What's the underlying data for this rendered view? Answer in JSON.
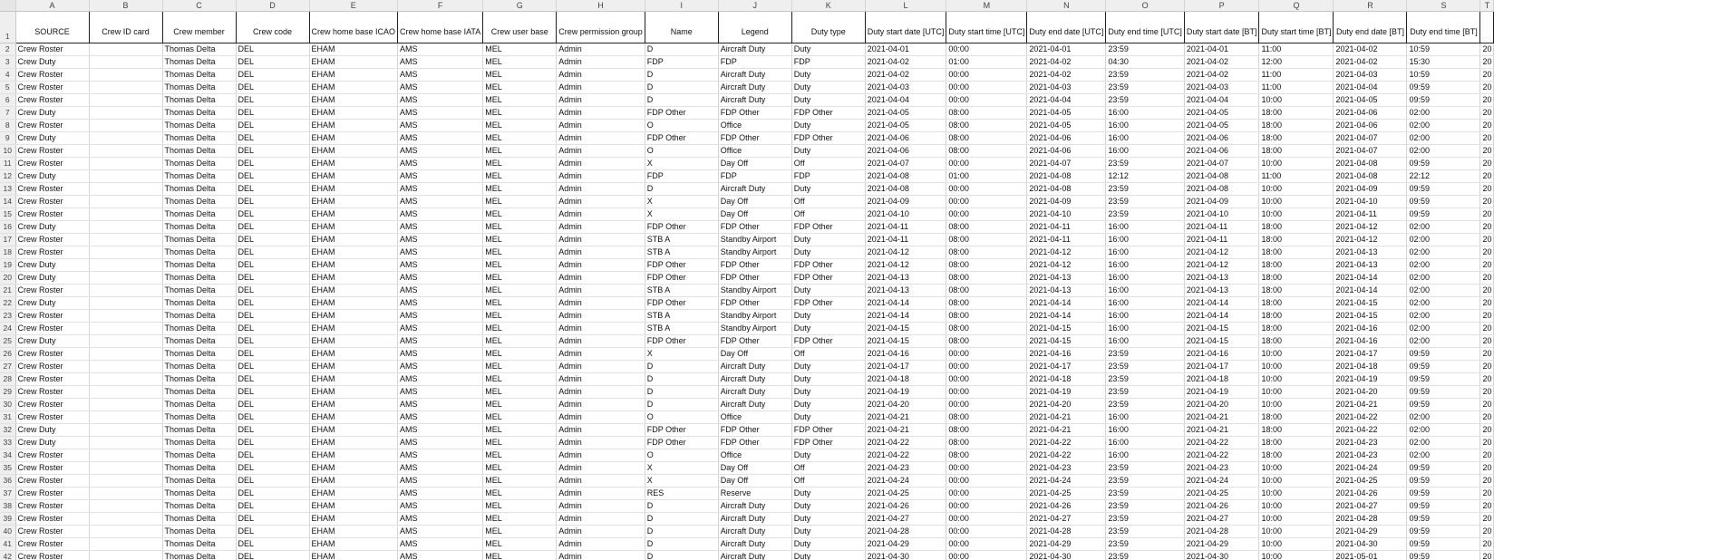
{
  "column_letters": [
    "A",
    "B",
    "C",
    "D",
    "E",
    "F",
    "G",
    "H",
    "I",
    "J",
    "K",
    "L",
    "M",
    "N",
    "O",
    "P",
    "Q",
    "R",
    "S",
    "T"
  ],
  "headers": [
    "SOURCE",
    "Crew ID card",
    "Crew member",
    "Crew code",
    "Crew home base ICAO",
    "Crew home base IATA",
    "Crew user base",
    "Crew permission group",
    "Name",
    "Legend",
    "Duty type",
    "Duty start date [UTC]",
    "Duty start time [UTC]",
    "Duty end date [UTC]",
    "Duty end time [UTC]",
    "Duty start date [BT]",
    "Duty start time [BT]",
    "Duty end date [BT]",
    "Duty end time [BT]",
    ""
  ],
  "row_numbers": [
    "1",
    "2",
    "3",
    "4",
    "5",
    "6",
    "7",
    "8",
    "9",
    "10",
    "11",
    "12",
    "13",
    "14",
    "15",
    "16",
    "17",
    "18",
    "19",
    "20",
    "21",
    "22",
    "23",
    "24",
    "25",
    "26",
    "27",
    "28",
    "29",
    "30",
    "31",
    "32",
    "33",
    "34",
    "35",
    "36",
    "37",
    "38",
    "39",
    "40",
    "41",
    "42"
  ],
  "rows": [
    [
      "Crew Roster",
      "",
      "Thomas Delta",
      "DEL",
      "EHAM",
      "AMS",
      "MEL",
      "Admin",
      "D",
      "Aircraft Duty",
      "Duty",
      "2021-04-01",
      "00:00",
      "2021-04-01",
      "23:59",
      "2021-04-01",
      "11:00",
      "2021-04-02",
      "10:59",
      "20"
    ],
    [
      "Crew Duty",
      "",
      "Thomas Delta",
      "DEL",
      "EHAM",
      "AMS",
      "MEL",
      "Admin",
      "FDP",
      "FDP",
      "FDP",
      "2021-04-02",
      "01:00",
      "2021-04-02",
      "04:30",
      "2021-04-02",
      "12:00",
      "2021-04-02",
      "15:30",
      "20"
    ],
    [
      "Crew Roster",
      "",
      "Thomas Delta",
      "DEL",
      "EHAM",
      "AMS",
      "MEL",
      "Admin",
      "D",
      "Aircraft Duty",
      "Duty",
      "2021-04-02",
      "00:00",
      "2021-04-02",
      "23:59",
      "2021-04-02",
      "11:00",
      "2021-04-03",
      "10:59",
      "20"
    ],
    [
      "Crew Roster",
      "",
      "Thomas Delta",
      "DEL",
      "EHAM",
      "AMS",
      "MEL",
      "Admin",
      "D",
      "Aircraft Duty",
      "Duty",
      "2021-04-03",
      "00:00",
      "2021-04-03",
      "23:59",
      "2021-04-03",
      "11:00",
      "2021-04-04",
      "09:59",
      "20"
    ],
    [
      "Crew Roster",
      "",
      "Thomas Delta",
      "DEL",
      "EHAM",
      "AMS",
      "MEL",
      "Admin",
      "D",
      "Aircraft Duty",
      "Duty",
      "2021-04-04",
      "00:00",
      "2021-04-04",
      "23:59",
      "2021-04-04",
      "10:00",
      "2021-04-05",
      "09:59",
      "20"
    ],
    [
      "Crew Duty",
      "",
      "Thomas Delta",
      "DEL",
      "EHAM",
      "AMS",
      "MEL",
      "Admin",
      "FDP Other",
      "FDP Other",
      "FDP Other",
      "2021-04-05",
      "08:00",
      "2021-04-05",
      "16:00",
      "2021-04-05",
      "18:00",
      "2021-04-06",
      "02:00",
      "20"
    ],
    [
      "Crew Roster",
      "",
      "Thomas Delta",
      "DEL",
      "EHAM",
      "AMS",
      "MEL",
      "Admin",
      "O",
      "Office",
      "Duty",
      "2021-04-05",
      "08:00",
      "2021-04-05",
      "16:00",
      "2021-04-05",
      "18:00",
      "2021-04-06",
      "02:00",
      "20"
    ],
    [
      "Crew Duty",
      "",
      "Thomas Delta",
      "DEL",
      "EHAM",
      "AMS",
      "MEL",
      "Admin",
      "FDP Other",
      "FDP Other",
      "FDP Other",
      "2021-04-06",
      "08:00",
      "2021-04-06",
      "16:00",
      "2021-04-06",
      "18:00",
      "2021-04-07",
      "02:00",
      "20"
    ],
    [
      "Crew Roster",
      "",
      "Thomas Delta",
      "DEL",
      "EHAM",
      "AMS",
      "MEL",
      "Admin",
      "O",
      "Office",
      "Duty",
      "2021-04-06",
      "08:00",
      "2021-04-06",
      "16:00",
      "2021-04-06",
      "18:00",
      "2021-04-07",
      "02:00",
      "20"
    ],
    [
      "Crew Roster",
      "",
      "Thomas Delta",
      "DEL",
      "EHAM",
      "AMS",
      "MEL",
      "Admin",
      "X",
      "Day Off",
      "Off",
      "2021-04-07",
      "00:00",
      "2021-04-07",
      "23:59",
      "2021-04-07",
      "10:00",
      "2021-04-08",
      "09:59",
      "20"
    ],
    [
      "Crew Duty",
      "",
      "Thomas Delta",
      "DEL",
      "EHAM",
      "AMS",
      "MEL",
      "Admin",
      "FDP",
      "FDP",
      "FDP",
      "2021-04-08",
      "01:00",
      "2021-04-08",
      "12:12",
      "2021-04-08",
      "11:00",
      "2021-04-08",
      "22:12",
      "20"
    ],
    [
      "Crew Roster",
      "",
      "Thomas Delta",
      "DEL",
      "EHAM",
      "AMS",
      "MEL",
      "Admin",
      "D",
      "Aircraft Duty",
      "Duty",
      "2021-04-08",
      "00:00",
      "2021-04-08",
      "23:59",
      "2021-04-08",
      "10:00",
      "2021-04-09",
      "09:59",
      "20"
    ],
    [
      "Crew Roster",
      "",
      "Thomas Delta",
      "DEL",
      "EHAM",
      "AMS",
      "MEL",
      "Admin",
      "X",
      "Day Off",
      "Off",
      "2021-04-09",
      "00:00",
      "2021-04-09",
      "23:59",
      "2021-04-09",
      "10:00",
      "2021-04-10",
      "09:59",
      "20"
    ],
    [
      "Crew Roster",
      "",
      "Thomas Delta",
      "DEL",
      "EHAM",
      "AMS",
      "MEL",
      "Admin",
      "X",
      "Day Off",
      "Off",
      "2021-04-10",
      "00:00",
      "2021-04-10",
      "23:59",
      "2021-04-10",
      "10:00",
      "2021-04-11",
      "09:59",
      "20"
    ],
    [
      "Crew Duty",
      "",
      "Thomas Delta",
      "DEL",
      "EHAM",
      "AMS",
      "MEL",
      "Admin",
      "FDP Other",
      "FDP Other",
      "FDP Other",
      "2021-04-11",
      "08:00",
      "2021-04-11",
      "16:00",
      "2021-04-11",
      "18:00",
      "2021-04-12",
      "02:00",
      "20"
    ],
    [
      "Crew Roster",
      "",
      "Thomas Delta",
      "DEL",
      "EHAM",
      "AMS",
      "MEL",
      "Admin",
      "STB A",
      "Standby Airport",
      "Duty",
      "2021-04-11",
      "08:00",
      "2021-04-11",
      "16:00",
      "2021-04-11",
      "18:00",
      "2021-04-12",
      "02:00",
      "20"
    ],
    [
      "Crew Roster",
      "",
      "Thomas Delta",
      "DEL",
      "EHAM",
      "AMS",
      "MEL",
      "Admin",
      "STB A",
      "Standby Airport",
      "Duty",
      "2021-04-12",
      "08:00",
      "2021-04-12",
      "16:00",
      "2021-04-12",
      "18:00",
      "2021-04-13",
      "02:00",
      "20"
    ],
    [
      "Crew Duty",
      "",
      "Thomas Delta",
      "DEL",
      "EHAM",
      "AMS",
      "MEL",
      "Admin",
      "FDP Other",
      "FDP Other",
      "FDP Other",
      "2021-04-12",
      "08:00",
      "2021-04-12",
      "16:00",
      "2021-04-12",
      "18:00",
      "2021-04-13",
      "02:00",
      "20"
    ],
    [
      "Crew Duty",
      "",
      "Thomas Delta",
      "DEL",
      "EHAM",
      "AMS",
      "MEL",
      "Admin",
      "FDP Other",
      "FDP Other",
      "FDP Other",
      "2021-04-13",
      "08:00",
      "2021-04-13",
      "16:00",
      "2021-04-13",
      "18:00",
      "2021-04-14",
      "02:00",
      "20"
    ],
    [
      "Crew Roster",
      "",
      "Thomas Delta",
      "DEL",
      "EHAM",
      "AMS",
      "MEL",
      "Admin",
      "STB A",
      "Standby Airport",
      "Duty",
      "2021-04-13",
      "08:00",
      "2021-04-13",
      "16:00",
      "2021-04-13",
      "18:00",
      "2021-04-14",
      "02:00",
      "20"
    ],
    [
      "Crew Duty",
      "",
      "Thomas Delta",
      "DEL",
      "EHAM",
      "AMS",
      "MEL",
      "Admin",
      "FDP Other",
      "FDP Other",
      "FDP Other",
      "2021-04-14",
      "08:00",
      "2021-04-14",
      "16:00",
      "2021-04-14",
      "18:00",
      "2021-04-15",
      "02:00",
      "20"
    ],
    [
      "Crew Roster",
      "",
      "Thomas Delta",
      "DEL",
      "EHAM",
      "AMS",
      "MEL",
      "Admin",
      "STB A",
      "Standby Airport",
      "Duty",
      "2021-04-14",
      "08:00",
      "2021-04-14",
      "16:00",
      "2021-04-14",
      "18:00",
      "2021-04-15",
      "02:00",
      "20"
    ],
    [
      "Crew Roster",
      "",
      "Thomas Delta",
      "DEL",
      "EHAM",
      "AMS",
      "MEL",
      "Admin",
      "STB A",
      "Standby Airport",
      "Duty",
      "2021-04-15",
      "08:00",
      "2021-04-15",
      "16:00",
      "2021-04-15",
      "18:00",
      "2021-04-16",
      "02:00",
      "20"
    ],
    [
      "Crew Duty",
      "",
      "Thomas Delta",
      "DEL",
      "EHAM",
      "AMS",
      "MEL",
      "Admin",
      "FDP Other",
      "FDP Other",
      "FDP Other",
      "2021-04-15",
      "08:00",
      "2021-04-15",
      "16:00",
      "2021-04-15",
      "18:00",
      "2021-04-16",
      "02:00",
      "20"
    ],
    [
      "Crew Roster",
      "",
      "Thomas Delta",
      "DEL",
      "EHAM",
      "AMS",
      "MEL",
      "Admin",
      "X",
      "Day Off",
      "Off",
      "2021-04-16",
      "00:00",
      "2021-04-16",
      "23:59",
      "2021-04-16",
      "10:00",
      "2021-04-17",
      "09:59",
      "20"
    ],
    [
      "Crew Roster",
      "",
      "Thomas Delta",
      "DEL",
      "EHAM",
      "AMS",
      "MEL",
      "Admin",
      "D",
      "Aircraft Duty",
      "Duty",
      "2021-04-17",
      "00:00",
      "2021-04-17",
      "23:59",
      "2021-04-17",
      "10:00",
      "2021-04-18",
      "09:59",
      "20"
    ],
    [
      "Crew Roster",
      "",
      "Thomas Delta",
      "DEL",
      "EHAM",
      "AMS",
      "MEL",
      "Admin",
      "D",
      "Aircraft Duty",
      "Duty",
      "2021-04-18",
      "00:00",
      "2021-04-18",
      "23:59",
      "2021-04-18",
      "10:00",
      "2021-04-19",
      "09:59",
      "20"
    ],
    [
      "Crew Roster",
      "",
      "Thomas Delta",
      "DEL",
      "EHAM",
      "AMS",
      "MEL",
      "Admin",
      "D",
      "Aircraft Duty",
      "Duty",
      "2021-04-19",
      "00:00",
      "2021-04-19",
      "23:59",
      "2021-04-19",
      "10:00",
      "2021-04-20",
      "09:59",
      "20"
    ],
    [
      "Crew Roster",
      "",
      "Thomas Delta",
      "DEL",
      "EHAM",
      "AMS",
      "MEL",
      "Admin",
      "D",
      "Aircraft Duty",
      "Duty",
      "2021-04-20",
      "00:00",
      "2021-04-20",
      "23:59",
      "2021-04-20",
      "10:00",
      "2021-04-21",
      "09:59",
      "20"
    ],
    [
      "Crew Roster",
      "",
      "Thomas Delta",
      "DEL",
      "EHAM",
      "AMS",
      "MEL",
      "Admin",
      "O",
      "Office",
      "Duty",
      "2021-04-21",
      "08:00",
      "2021-04-21",
      "16:00",
      "2021-04-21",
      "18:00",
      "2021-04-22",
      "02:00",
      "20"
    ],
    [
      "Crew Duty",
      "",
      "Thomas Delta",
      "DEL",
      "EHAM",
      "AMS",
      "MEL",
      "Admin",
      "FDP Other",
      "FDP Other",
      "FDP Other",
      "2021-04-21",
      "08:00",
      "2021-04-21",
      "16:00",
      "2021-04-21",
      "18:00",
      "2021-04-22",
      "02:00",
      "20"
    ],
    [
      "Crew Duty",
      "",
      "Thomas Delta",
      "DEL",
      "EHAM",
      "AMS",
      "MEL",
      "Admin",
      "FDP Other",
      "FDP Other",
      "FDP Other",
      "2021-04-22",
      "08:00",
      "2021-04-22",
      "16:00",
      "2021-04-22",
      "18:00",
      "2021-04-23",
      "02:00",
      "20"
    ],
    [
      "Crew Roster",
      "",
      "Thomas Delta",
      "DEL",
      "EHAM",
      "AMS",
      "MEL",
      "Admin",
      "O",
      "Office",
      "Duty",
      "2021-04-22",
      "08:00",
      "2021-04-22",
      "16:00",
      "2021-04-22",
      "18:00",
      "2021-04-23",
      "02:00",
      "20"
    ],
    [
      "Crew Roster",
      "",
      "Thomas Delta",
      "DEL",
      "EHAM",
      "AMS",
      "MEL",
      "Admin",
      "X",
      "Day Off",
      "Off",
      "2021-04-23",
      "00:00",
      "2021-04-23",
      "23:59",
      "2021-04-23",
      "10:00",
      "2021-04-24",
      "09:59",
      "20"
    ],
    [
      "Crew Roster",
      "",
      "Thomas Delta",
      "DEL",
      "EHAM",
      "AMS",
      "MEL",
      "Admin",
      "X",
      "Day Off",
      "Off",
      "2021-04-24",
      "00:00",
      "2021-04-24",
      "23:59",
      "2021-04-24",
      "10:00",
      "2021-04-25",
      "09:59",
      "20"
    ],
    [
      "Crew Roster",
      "",
      "Thomas Delta",
      "DEL",
      "EHAM",
      "AMS",
      "MEL",
      "Admin",
      "RES",
      "Reserve",
      "Duty",
      "2021-04-25",
      "00:00",
      "2021-04-25",
      "23:59",
      "2021-04-25",
      "10:00",
      "2021-04-26",
      "09:59",
      "20"
    ],
    [
      "Crew Roster",
      "",
      "Thomas Delta",
      "DEL",
      "EHAM",
      "AMS",
      "MEL",
      "Admin",
      "D",
      "Aircraft Duty",
      "Duty",
      "2021-04-26",
      "00:00",
      "2021-04-26",
      "23:59",
      "2021-04-26",
      "10:00",
      "2021-04-27",
      "09:59",
      "20"
    ],
    [
      "Crew Roster",
      "",
      "Thomas Delta",
      "DEL",
      "EHAM",
      "AMS",
      "MEL",
      "Admin",
      "D",
      "Aircraft Duty",
      "Duty",
      "2021-04-27",
      "00:00",
      "2021-04-27",
      "23:59",
      "2021-04-27",
      "10:00",
      "2021-04-28",
      "09:59",
      "20"
    ],
    [
      "Crew Roster",
      "",
      "Thomas Delta",
      "DEL",
      "EHAM",
      "AMS",
      "MEL",
      "Admin",
      "D",
      "Aircraft Duty",
      "Duty",
      "2021-04-28",
      "00:00",
      "2021-04-28",
      "23:59",
      "2021-04-28",
      "10:00",
      "2021-04-29",
      "09:59",
      "20"
    ],
    [
      "Crew Roster",
      "",
      "Thomas Delta",
      "DEL",
      "EHAM",
      "AMS",
      "MEL",
      "Admin",
      "D",
      "Aircraft Duty",
      "Duty",
      "2021-04-29",
      "00:00",
      "2021-04-29",
      "23:59",
      "2021-04-29",
      "10:00",
      "2021-04-30",
      "09:59",
      "20"
    ],
    [
      "Crew Roster",
      "",
      "Thomas Delta",
      "DEL",
      "EHAM",
      "AMS",
      "MEL",
      "Admin",
      "D",
      "Aircraft Duty",
      "Duty",
      "2021-04-30",
      "00:00",
      "2021-04-30",
      "23:59",
      "2021-04-30",
      "10:00",
      "2021-05-01",
      "09:59",
      "20"
    ]
  ]
}
